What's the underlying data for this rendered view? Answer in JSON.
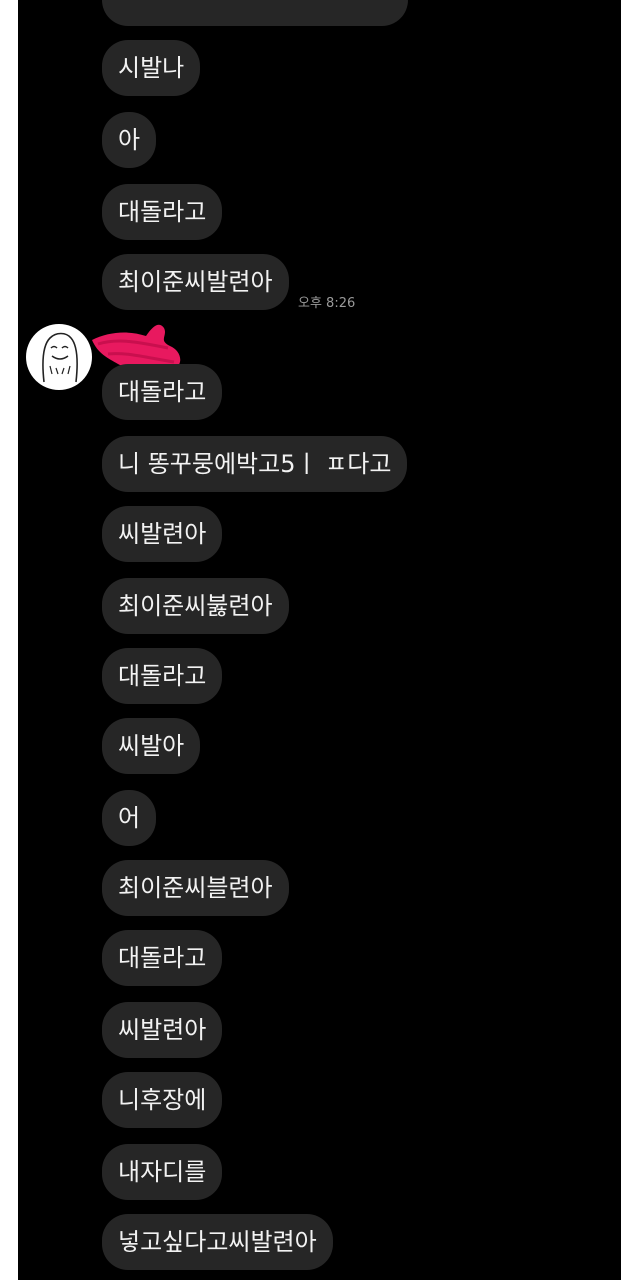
{
  "timestamp": "오후 8:26",
  "messages": [
    "",
    "시발나",
    "아",
    "대돌라고",
    "최이준씨발련아",
    "대돌라고",
    "니 똥꾸뭉에박고5ㅣ ㅍ다고",
    "씨발련아",
    "최이준씨붏련아",
    "대돌라고",
    "씨발아",
    "어",
    "최이준씨블련아",
    "대돌라고",
    "씨발련아",
    "니후장에",
    "내자디를",
    "넣고싶다고씨발련아"
  ],
  "colors": {
    "background": "#000000",
    "bubble": "#262626",
    "text": "#f2f2f2",
    "timestamp": "#9a9a9a",
    "redaction": "#e8195f"
  }
}
